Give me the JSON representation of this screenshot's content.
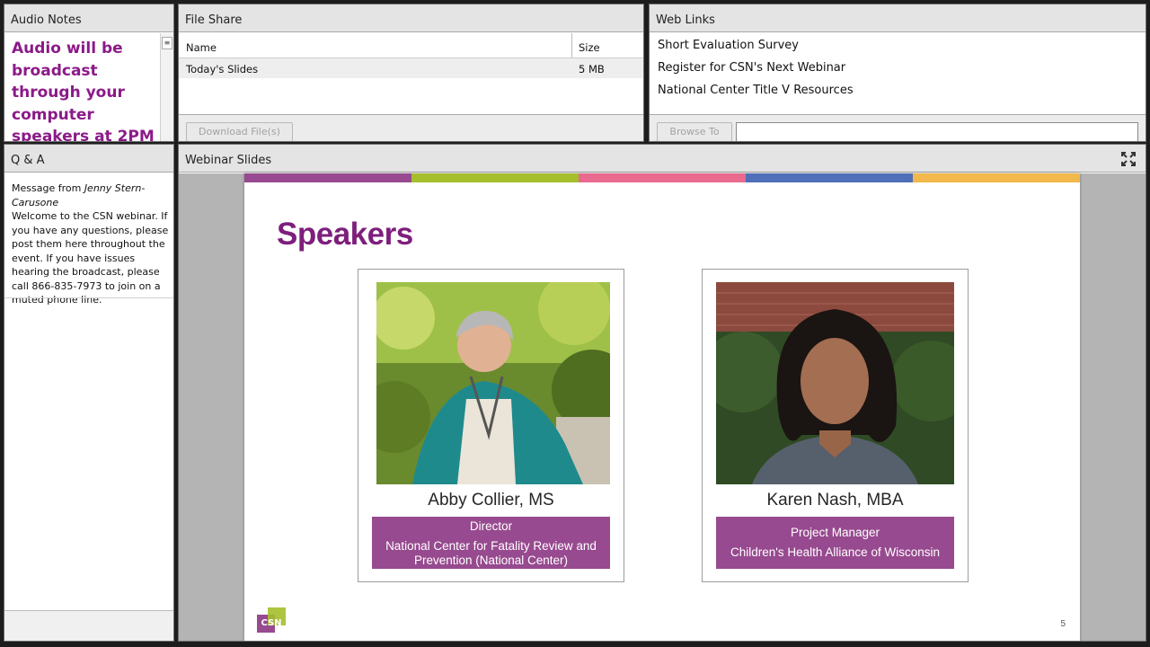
{
  "audio_notes": {
    "title": "Audio Notes",
    "text": "Audio will be broadcast through your computer speakers at 2PM"
  },
  "file_share": {
    "title": "File Share",
    "columns": {
      "name": "Name",
      "size": "Size"
    },
    "files": [
      {
        "name": "Today's Slides",
        "size": "5 MB"
      }
    ],
    "download_label": "Download File(s)"
  },
  "web_links": {
    "title": "Web Links",
    "links": [
      "Short Evaluation Survey",
      "Register for CSN's Next Webinar",
      "National Center Title V Resources"
    ],
    "browse_label": "Browse To"
  },
  "qa": {
    "title": "Q & A",
    "message_prefix": "Message from",
    "sender": "Jenny Stern-Carusone",
    "message": "Welcome to the CSN webinar.  If you have any questions, please post them here throughout the event.  If you have issues hearing the broadcast, please call 866-835-7973 to join on a muted phone line."
  },
  "slides": {
    "title": "Webinar Slides",
    "slide_title": "Speakers",
    "page_number": "5",
    "logo_text": "CSN",
    "stripe_colors": [
      "#974a8f",
      "#a4bf2b",
      "#e96a8e",
      "#4f6fb8",
      "#f2b84b"
    ],
    "speakers": [
      {
        "name": "Abby Collier, MS",
        "role": "Director",
        "org": "National Center for Fatality Review and Prevention (National Center)"
      },
      {
        "name": "Karen Nash, MBA",
        "role": "Project Manager",
        "org": "Children's Health Alliance of Wisconsin"
      }
    ]
  },
  "colors": {
    "accent_purple": "#8b1a88",
    "role_box": "#974a8f"
  }
}
